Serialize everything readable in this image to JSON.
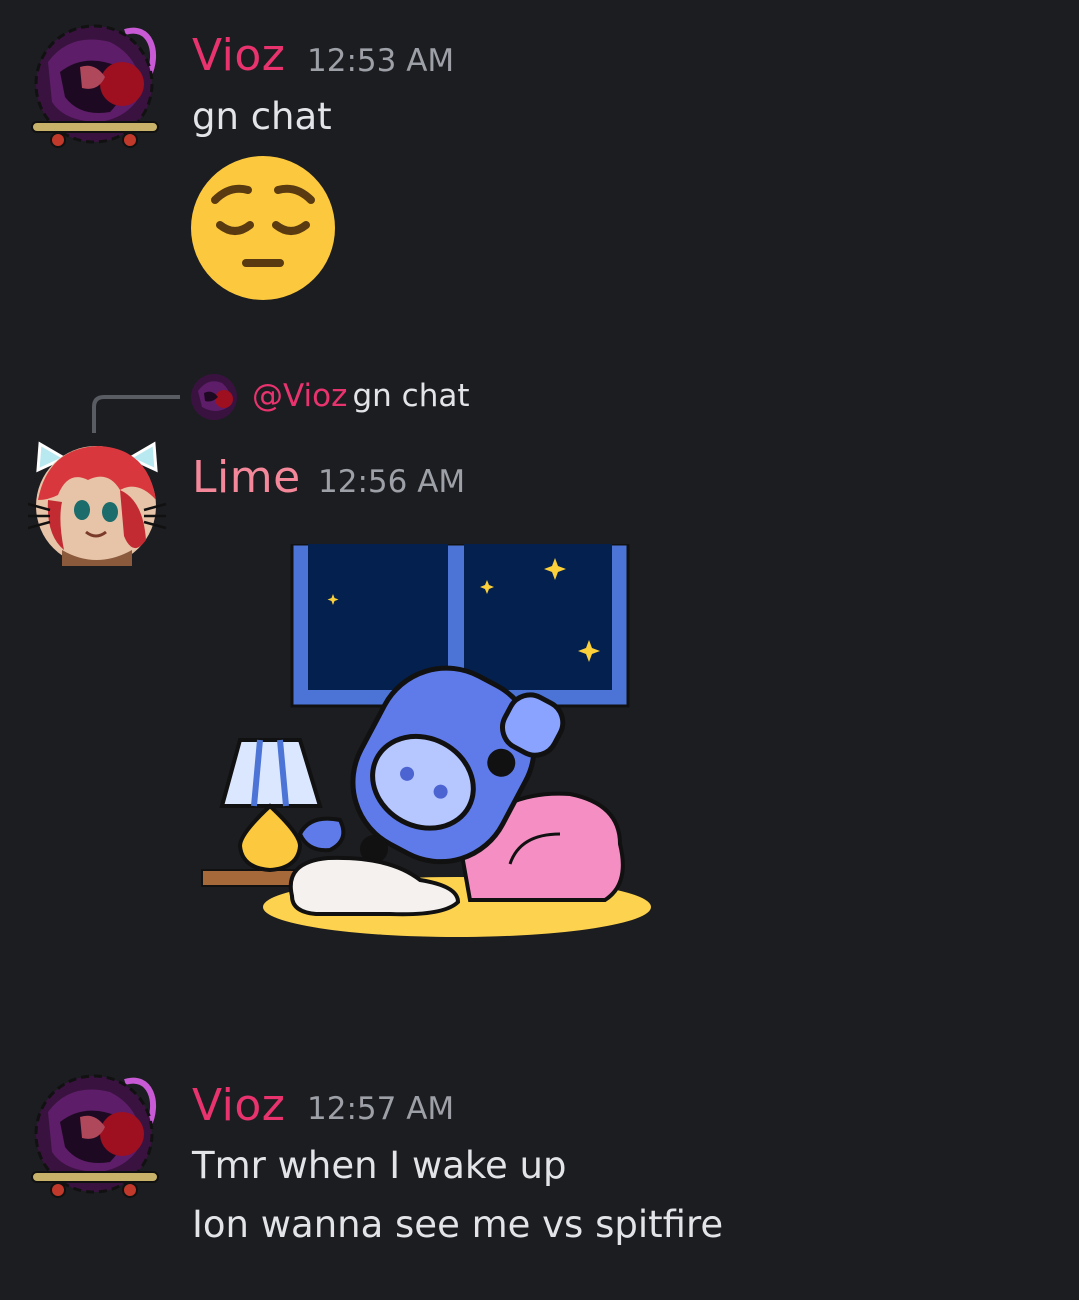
{
  "messages": [
    {
      "author": "Vioz",
      "time": "12:53 AM",
      "text": "gn chat",
      "emoji": "pensive-face"
    },
    {
      "reply": {
        "mention": "@Vioz",
        "text": "gn chat"
      },
      "author": "Lime",
      "time": "12:56 AM",
      "sticker": "sleeping-wumpus"
    },
    {
      "author": "Vioz",
      "time": "12:57 AM",
      "lines": [
        "Tmr when I wake up",
        "Ion wanna see me vs spitfire"
      ]
    }
  ],
  "colors": {
    "background": "#1c1d21",
    "vioz": "#e8336e",
    "lime": "#f4889a",
    "timestamp": "#9ea0a8",
    "text": "#e3e4e8"
  }
}
